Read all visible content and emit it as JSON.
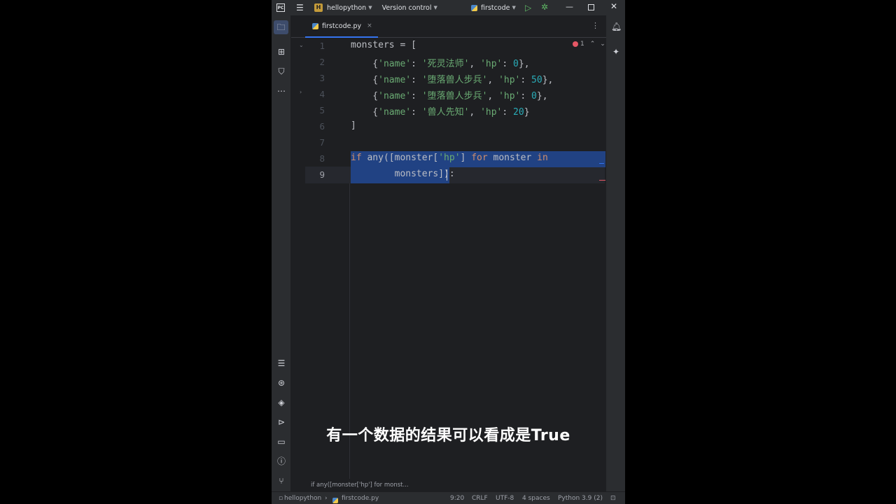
{
  "titlebar": {
    "project_badge": "H",
    "project_name": "hellopython",
    "version_control": "Version control",
    "run_config": "firstcode"
  },
  "tab": {
    "filename": "firstcode.py",
    "close": "×"
  },
  "problems": {
    "count": "1"
  },
  "editor": {
    "line_numbers": [
      "1",
      "2",
      "3",
      "4",
      "5",
      "6",
      "7",
      "8",
      "9"
    ],
    "lines": [
      "monsters = [",
      "    {'name': '死灵法师', 'hp': 0},",
      "    {'name': '堕落兽人步兵', 'hp': 50},",
      "    {'name': '堕落兽人步兵', 'hp': 0},",
      "    {'name': '兽人先知', 'hp': 20}",
      "]",
      "",
      "if any([monster['hp'] for monster in",
      "        monsters]):"
    ]
  },
  "breadcrumb": "if any([monster['hp'] for monst...",
  "statusbar": {
    "project": "hellopython",
    "file": "firstcode.py",
    "position": "9:20",
    "line_sep": "CRLF",
    "encoding": "UTF-8",
    "indent": "4 spaces",
    "interpreter": "Python 3.9 (2)"
  },
  "subtitle": "有一个数据的结果可以看成是True",
  "colors": {
    "accent": "#3574f0",
    "selection": "#214283",
    "string": "#6aab73",
    "number": "#2aacb8",
    "keyword": "#cf8e6d"
  }
}
